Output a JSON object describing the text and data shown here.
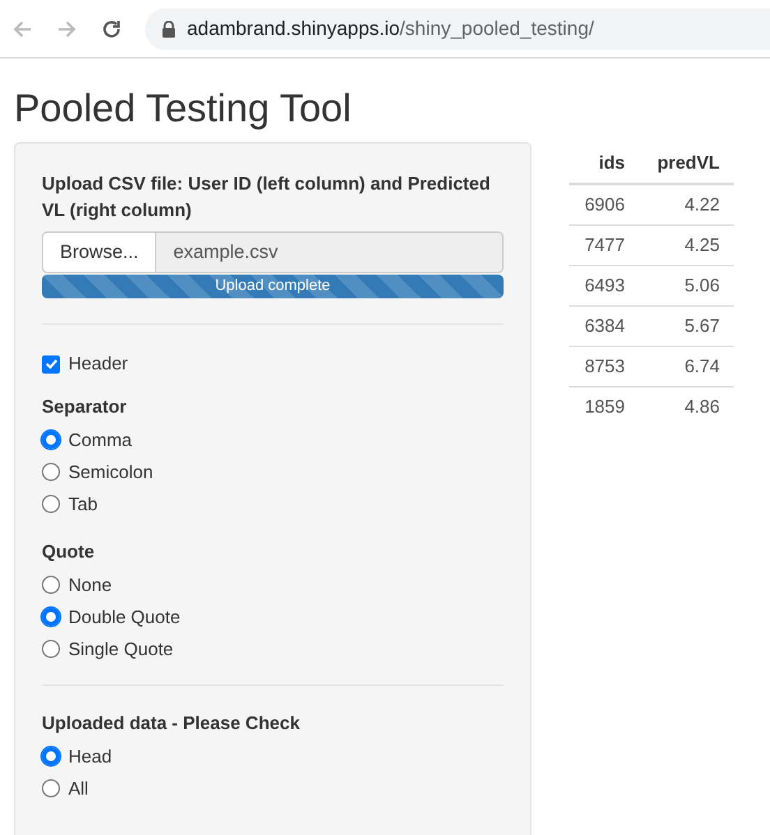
{
  "browser": {
    "url_host": "adambrand.shinyapps.io",
    "url_path": "/shiny_pooled_testing/"
  },
  "title": "Pooled Testing Tool",
  "upload": {
    "label": "Upload CSV file: User ID (left column) and Predicted VL (right column)",
    "button": "Browse...",
    "filename": "example.csv",
    "progress_text": "Upload complete",
    "level": 1
  },
  "header_checkbox": {
    "label": "Header",
    "checked": true
  },
  "radio_groups": [
    {
      "label": "Separator",
      "options": [
        {
          "label": "Comma",
          "selected": true
        },
        {
          "label": "Semicolon",
          "selected": false
        },
        {
          "label": "Tab",
          "selected": false
        }
      ]
    },
    {
      "label": "Quote",
      "options": [
        {
          "label": "None",
          "selected": false
        },
        {
          "label": "Double Quote",
          "selected": true
        },
        {
          "label": "Single Quote",
          "selected": false
        }
      ]
    },
    {
      "label": "Uploaded data - Please Check",
      "divider_before": true,
      "options": [
        {
          "label": "Head",
          "selected": true
        },
        {
          "label": "All",
          "selected": false
        }
      ]
    }
  ],
  "table": {
    "columns": [
      "ids",
      "predVL"
    ],
    "rows": [
      [
        "6906",
        "4.22"
      ],
      [
        "7477",
        "4.25"
      ],
      [
        "6493",
        "5.06"
      ],
      [
        "6384",
        "5.67"
      ],
      [
        "8753",
        "6.74"
      ],
      [
        "1859",
        "4.86"
      ]
    ]
  }
}
